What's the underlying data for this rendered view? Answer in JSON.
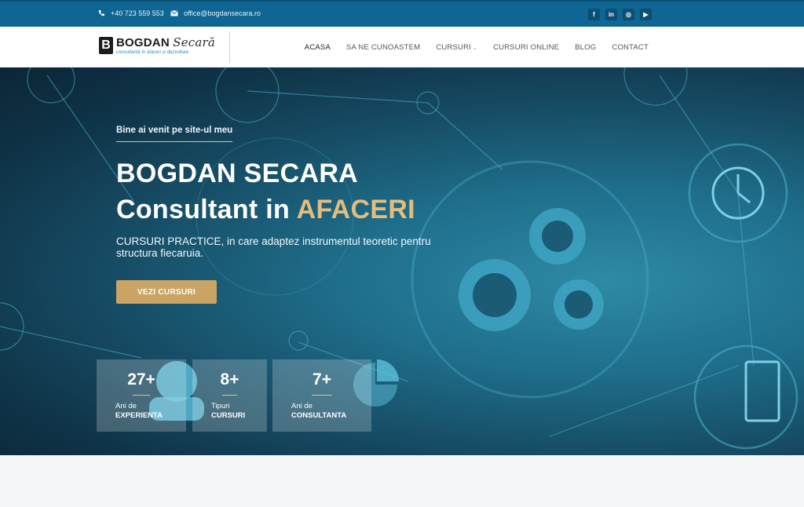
{
  "topbar": {
    "phone": "+40 723 559 553",
    "email": "office@bogdansecara.ro",
    "socials": [
      "f",
      "in",
      "◎",
      "▶"
    ]
  },
  "logo": {
    "mark": "B",
    "name_bold": "BOGDAN",
    "name_script": "Secară",
    "tagline": "consultanță în afaceri și dezvoltare"
  },
  "nav": {
    "items": [
      "ACASA",
      "SA NE CUNOASTEM",
      "CURSURI",
      "CURSURI ONLINE",
      "BLOG",
      "CONTACT"
    ]
  },
  "hero": {
    "welcome": "Bine ai venit pe site-ul meu",
    "title_line1": "BOGDAN SECARA",
    "title_line2_prefix": "Consultant in ",
    "title_line2_highlight": "AFACERI",
    "subtitle": "CURSURI PRACTICE, in care adaptez instrumentul teoretic pentru structura fiecaruia.",
    "cta": "VEZI CURSURI"
  },
  "stats": [
    {
      "value": "27+",
      "label1": "Ani de",
      "label2": "EXPERIENTA"
    },
    {
      "value": "8+",
      "label1": "Tipuri",
      "label2": "CURSURI"
    },
    {
      "value": "7+",
      "label1": "Ani de",
      "label2": "CONSULTANTA"
    }
  ],
  "colors": {
    "topbar": "#0f6593",
    "gold": "#c9a464",
    "accent_text": "#e2bd7d"
  }
}
